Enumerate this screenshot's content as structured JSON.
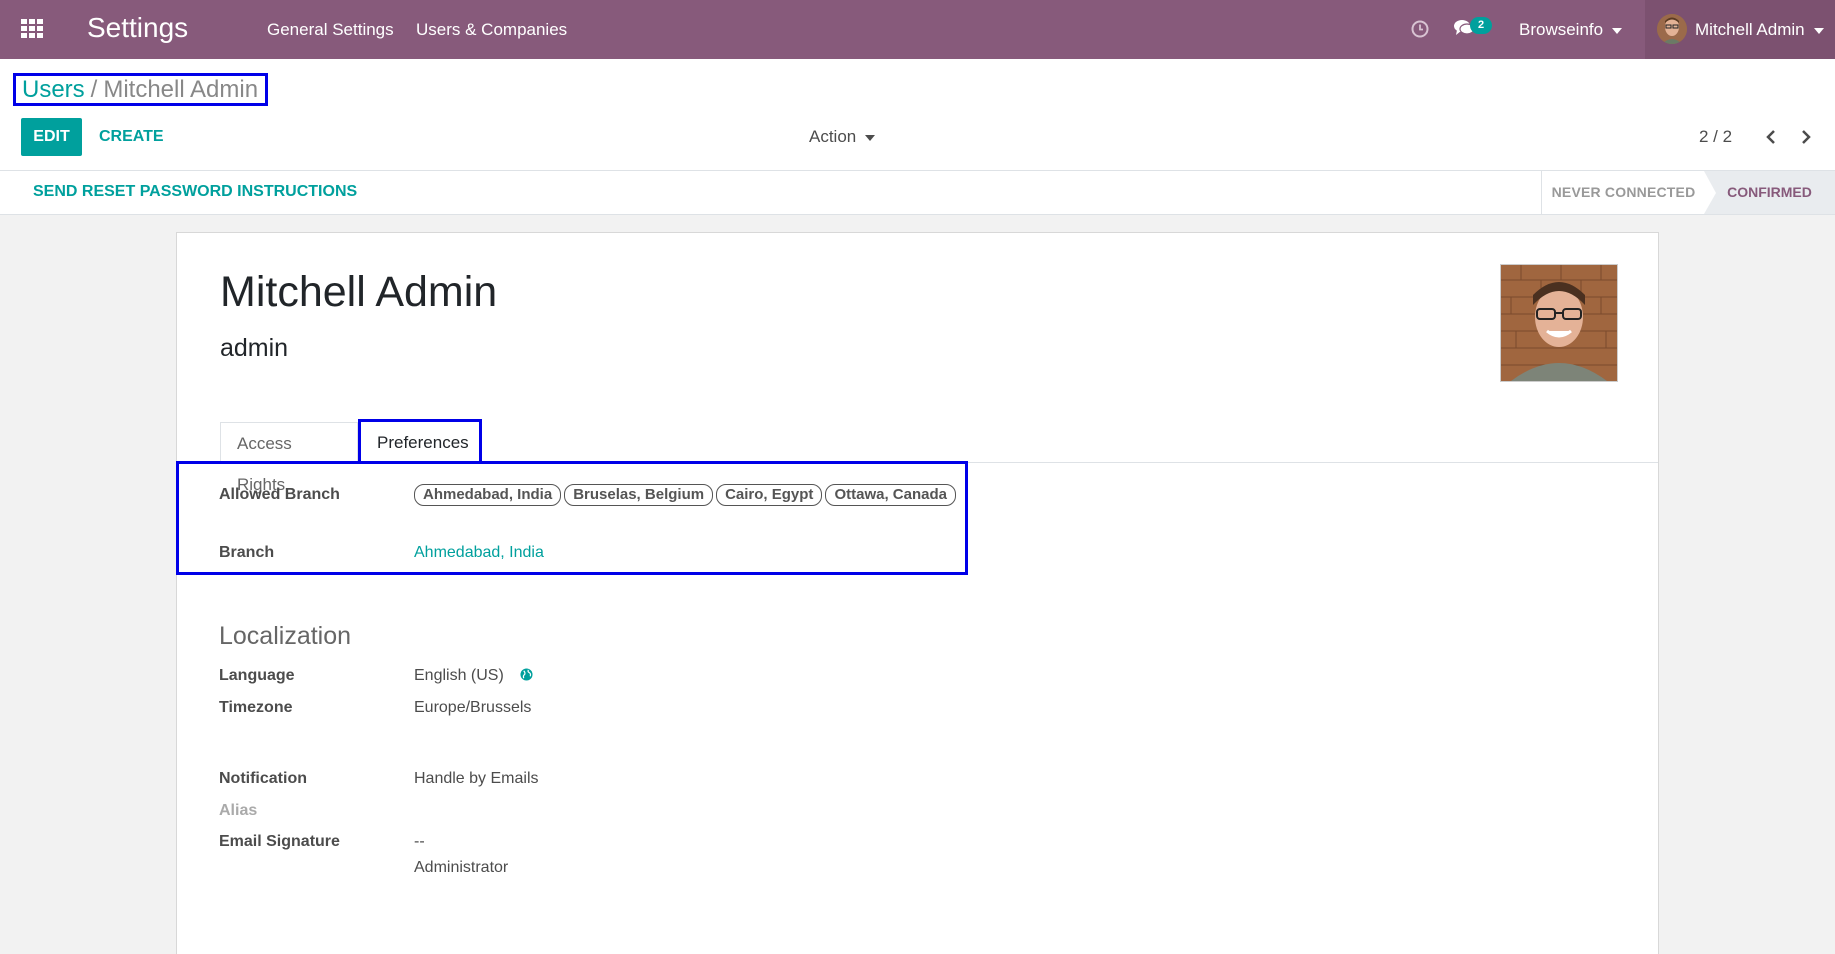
{
  "navbar": {
    "app_title": "Settings",
    "menu": [
      "General Settings",
      "Users & Companies"
    ],
    "chat_count": "2",
    "company": "Browseinfo",
    "user": "Mitchell Admin",
    "bg_color": "#875a7b"
  },
  "breadcrumb": {
    "parent": "Users",
    "separator": "/",
    "current": "Mitchell Admin"
  },
  "toolbar": {
    "edit_label": "EDIT",
    "create_label": "CREATE",
    "action_label": "Action",
    "pager": "2 / 2"
  },
  "status_bar": {
    "reset_label": "SEND RESET PASSWORD INSTRUCTIONS",
    "states": [
      "NEVER CONNECTED",
      "CONFIRMED"
    ],
    "active_state": "CONFIRMED"
  },
  "form": {
    "name": "Mitchell Admin",
    "login": "admin",
    "tabs": [
      "Access Rights",
      "Preferences"
    ],
    "active_tab": "Preferences",
    "allowed_branch_label": "Allowed Branch",
    "allowed_branches": [
      "Ahmedabad, India",
      "Bruselas, Belgium",
      "Cairo, Egypt",
      "Ottawa, Canada"
    ],
    "branch_label": "Branch",
    "branch_value": "Ahmedabad, India",
    "localization_title": "Localization",
    "language_label": "Language",
    "language_value": "English (US)",
    "timezone_label": "Timezone",
    "timezone_value": "Europe/Brussels",
    "notification_label": "Notification",
    "notification_value": "Handle by Emails",
    "alias_label": "Alias",
    "signature_label": "Email Signature",
    "signature_line1": "--",
    "signature_line2": "Administrator"
  },
  "colors": {
    "accent": "#00a09d",
    "brand": "#875a7b",
    "highlight": "#0000e8"
  }
}
